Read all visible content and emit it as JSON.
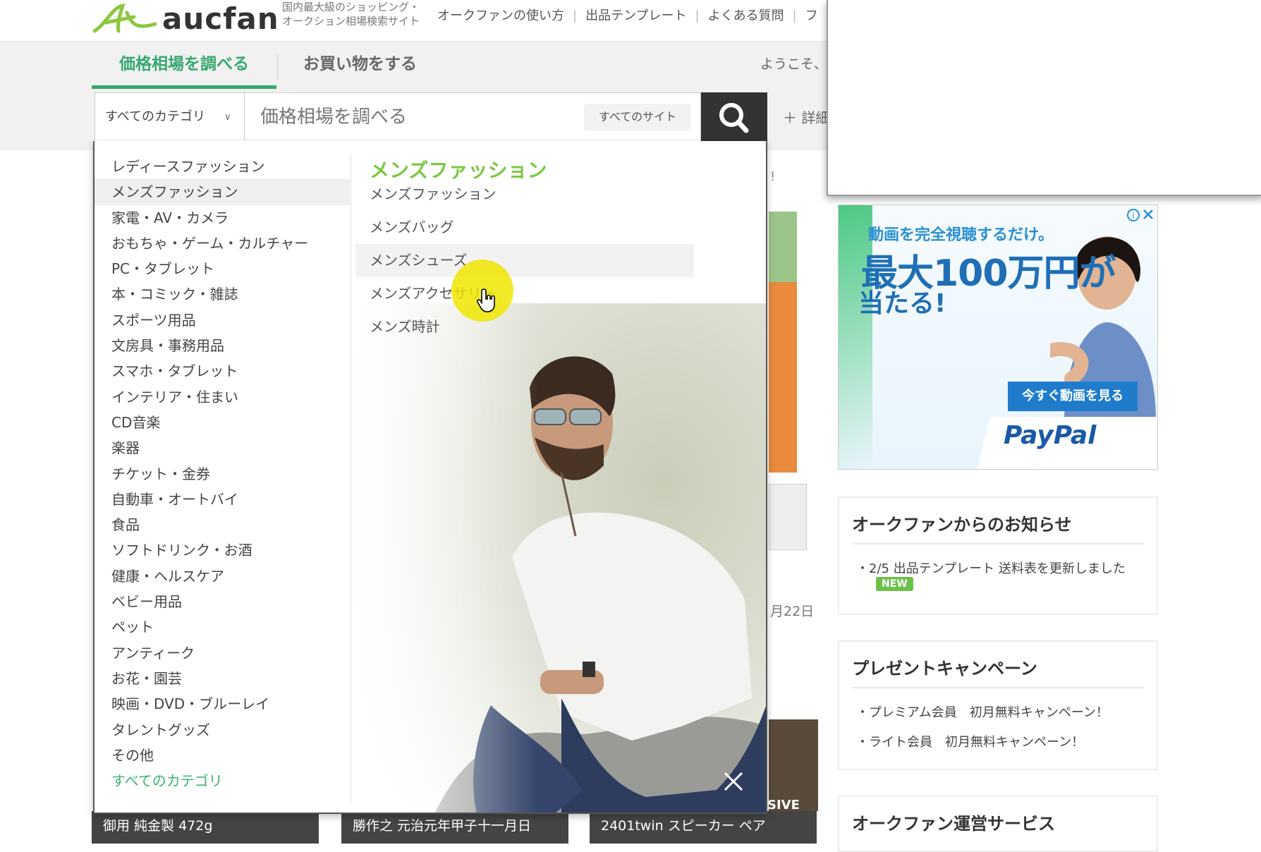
{
  "header": {
    "logo_text": "aucfan",
    "tagline_line1": "国内最大級のショッピング・",
    "tagline_line2": "オークション相場検索サイト",
    "nav": [
      "オークファンの使い方",
      "出品テンプレート",
      "よくある質問",
      "フ"
    ]
  },
  "tabs": {
    "price": "価格相場を調べる",
    "shop": "お買い物をする",
    "welcome": "ようこそ、",
    "detail": "＋ 詳細"
  },
  "search": {
    "category": "すべてのカテゴリ",
    "placeholder": "価格相場を調べる",
    "site": "すべてのサイト"
  },
  "categories": [
    "レディースファッション",
    "メンズファッション",
    "家電・AV・カメラ",
    "おもちゃ・ゲーム・カルチャー",
    "PC・タブレット",
    "本・コミック・雑誌",
    "スポーツ用品",
    "文房具・事務用品",
    "スマホ・タブレット",
    "インテリア・住まい",
    "CD音楽",
    "楽器",
    "チケット・金券",
    "自動車・オートバイ",
    "食品",
    "ソフトドリンク・お酒",
    "健康・ヘルスケア",
    "ベビー用品",
    "ペット",
    "アンティーク",
    "お花・園芸",
    "映画・DVD・ブルーレイ",
    "タレントグッズ",
    "その他"
  ],
  "all_categories_label": "すべてのカテゴリ",
  "subcategory": {
    "title": "メンズファッション",
    "items": [
      "メンズファッション",
      "メンズバッグ",
      "メンズシューズ",
      "メンズアクセサリー",
      "メンズ時計"
    ]
  },
  "middle": {
    "date_fragment": "月22日",
    "sive": "SIVE",
    "exclaim": "!"
  },
  "captions": [
    "御用 純金製 472g",
    "勝作之 元治元年甲子十一月日",
    "2401twin スピーカー ペア"
  ],
  "ad": {
    "line1": "動画を完全視聴するだけ。",
    "line2": "最大100万円が",
    "line3": "当たる!",
    "cta": "今すぐ動画を見る",
    "brand": "PayPal"
  },
  "news": {
    "title": "オークファンからのお知らせ",
    "items": [
      "・2/5 出品テンプレート 送料表を更新しました"
    ],
    "badge": "NEW"
  },
  "campaign": {
    "title": "プレゼントキャンペーン",
    "items": [
      "・プレミアム会員　初月無料キャンペーン！",
      "・ライト会員　初月無料キャンペーン！"
    ]
  },
  "services": {
    "title": "オークファン運営サービス"
  },
  "colors": {
    "accent_green": "#34a86e",
    "sub_title_green": "#7ac943",
    "search_button": "#333333"
  }
}
